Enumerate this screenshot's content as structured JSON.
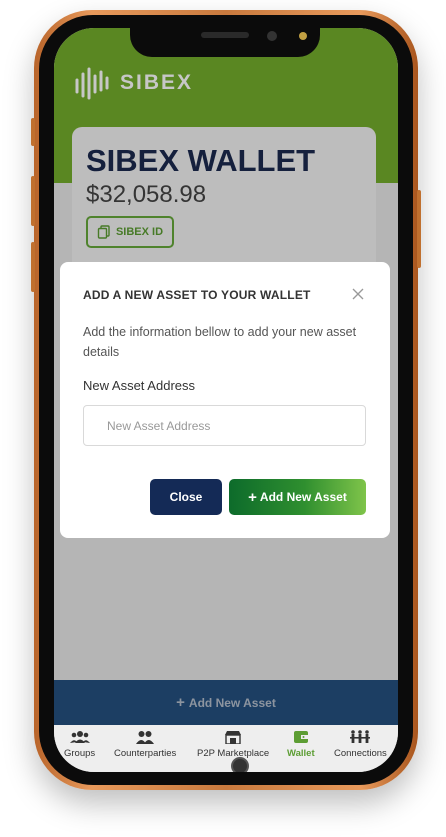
{
  "brand": {
    "logo_text": "SIBEX"
  },
  "wallet": {
    "title": "SIBEX WALLET",
    "balance": "$32,058.98",
    "id_button_label": "SIBEX ID"
  },
  "modal": {
    "title": "ADD A NEW ASSET TO YOUR WALLET",
    "description": "Add the information bellow to add your new asset details",
    "field_label": "New Asset Address",
    "field_placeholder": "New Asset Address",
    "field_value": "",
    "close_label": "Close",
    "add_label": "Add New Asset"
  },
  "bottom_action": {
    "label": "Add New Asset"
  },
  "nav": {
    "items": [
      {
        "label": "Groups",
        "icon": "groups-icon"
      },
      {
        "label": "Counterparties",
        "icon": "counterparties-icon"
      },
      {
        "label": "P2P Marketplace",
        "icon": "marketplace-icon"
      },
      {
        "label": "Wallet",
        "icon": "wallet-icon",
        "active": true
      },
      {
        "label": "Connections",
        "icon": "connections-icon"
      }
    ]
  },
  "colors": {
    "brand_green": "#74ad2c",
    "navy": "#142a56",
    "accent_green": "#5c9d33",
    "action_blue": "#2a5a8f"
  }
}
